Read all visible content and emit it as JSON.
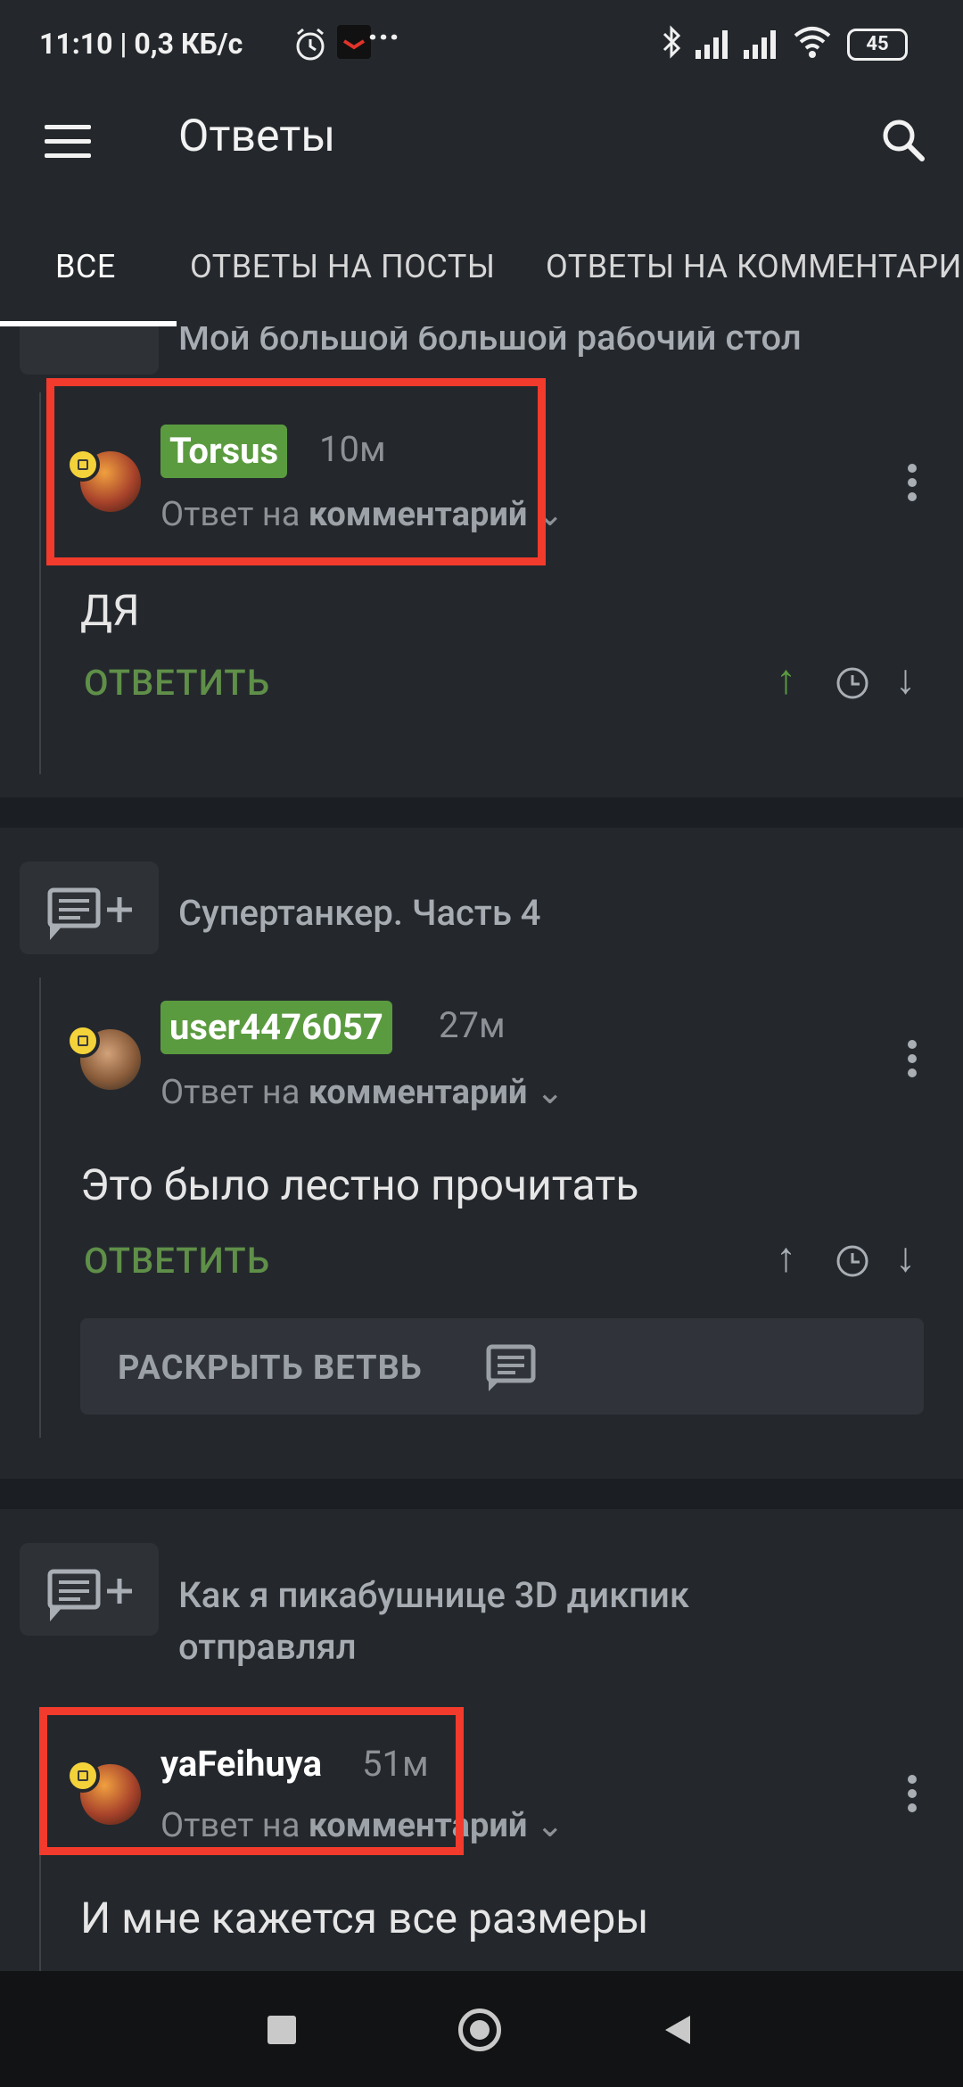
{
  "status_bar": {
    "time_speed": "11:10 | 0,3 КБ/с",
    "dots": "···",
    "battery": "45"
  },
  "app_bar": {
    "title": "Ответы"
  },
  "tabs": [
    {
      "label": "ВСЕ",
      "active": true
    },
    {
      "label": "ОТВЕТЫ НА ПОСТЫ",
      "active": false
    },
    {
      "label": "ОТВЕТЫ НА КОММЕНТАРИИ",
      "active": false
    }
  ],
  "feed": {
    "post1": {
      "title": "Мой большой большой рабочий стол",
      "comment": {
        "username": "Torsus",
        "time": "10м",
        "reply_prefix": "Ответ на",
        "reply_target": "комментарий",
        "text": "ДЯ",
        "reply_label": "ОТВЕТИТЬ"
      }
    },
    "post2": {
      "title": "Супертанкер. Часть 4",
      "comment": {
        "username": "user4476057",
        "time": "27м",
        "reply_prefix": "Ответ на",
        "reply_target": "комментарий",
        "text": "Это было лестно прочитать",
        "reply_label": "ОТВЕТИТЬ",
        "expand_label": "РАСКРЫТЬ ВЕТВЬ"
      }
    },
    "post3": {
      "title_line1": "Как я пикабушнице 3D дикпик",
      "title_line2": "отправлял",
      "comment": {
        "username": "yaFeihuya",
        "time": "51м",
        "reply_prefix": "Ответ на",
        "reply_target": "комментарий",
        "text": "И мне кажется все размеры"
      }
    }
  },
  "colors": {
    "background": "#24282d",
    "accent_green": "#5b9b40",
    "highlight_red": "#f23b2c"
  }
}
